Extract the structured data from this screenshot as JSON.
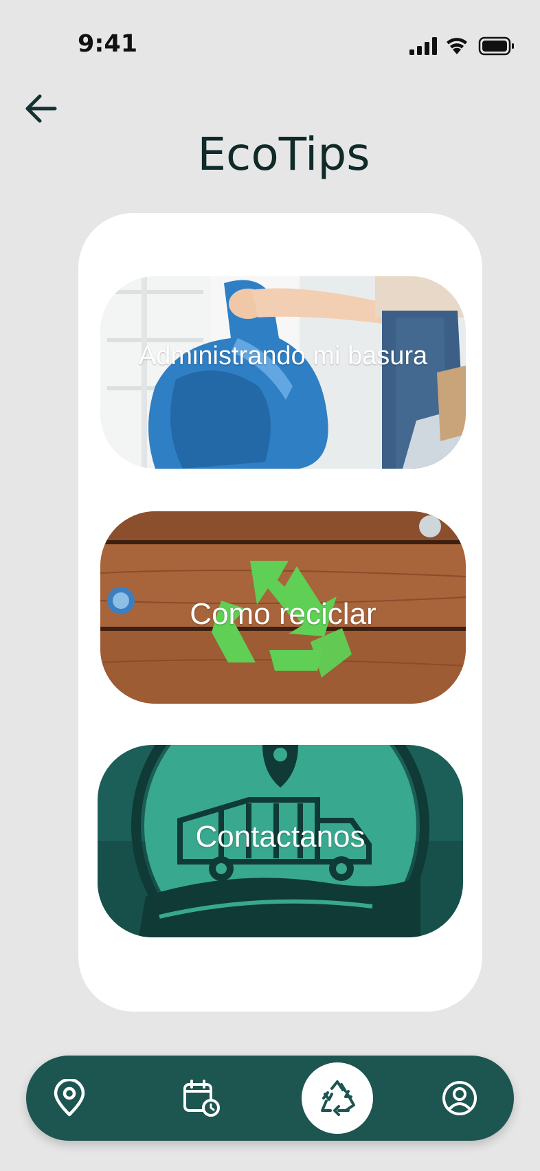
{
  "status_bar": {
    "time": "9:41"
  },
  "header": {
    "title": "EcoTips"
  },
  "cards": [
    {
      "label": "Administrando mi basura"
    },
    {
      "label": "Como reciclar"
    },
    {
      "label": "Contactanos"
    }
  ],
  "bottom_nav": {
    "items": [
      "location-pin-icon",
      "calendar-clock-icon",
      "recycle-icon",
      "user-profile-icon"
    ],
    "active": "recycle-icon"
  },
  "colors": {
    "background": "#e6e6e7",
    "nav": "#1d5550",
    "title": "#0f2a28"
  }
}
